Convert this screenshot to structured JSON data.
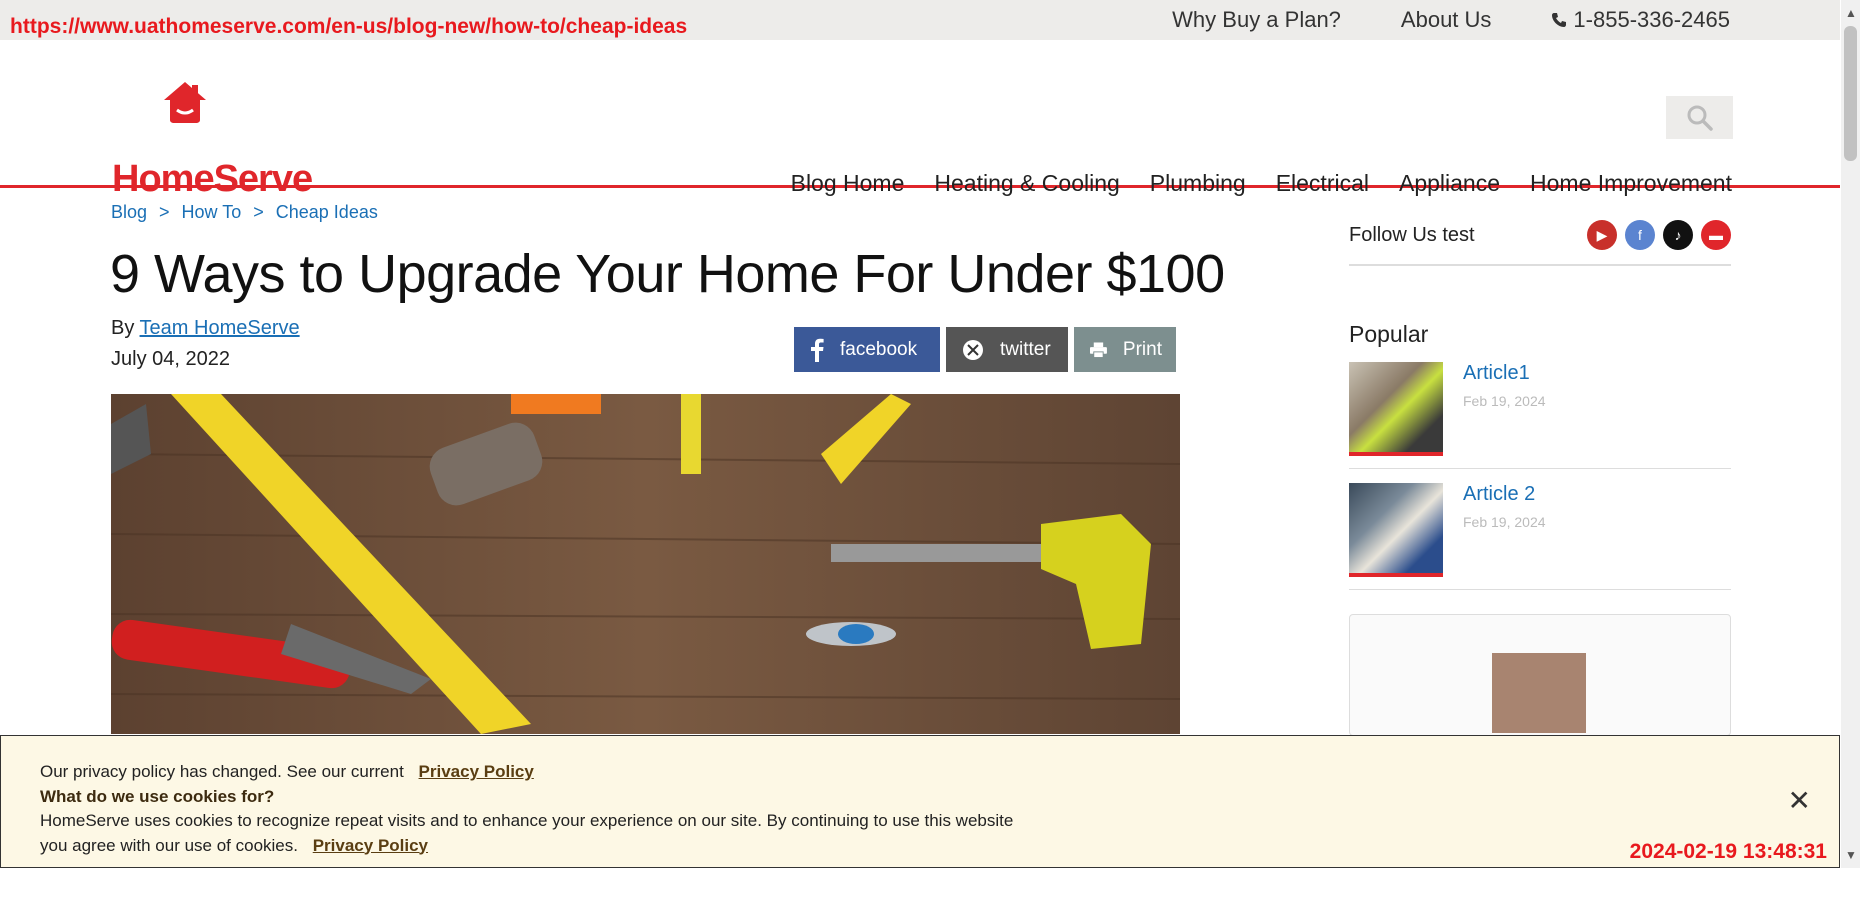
{
  "overlay": {
    "url": "https://www.uathomeserve.com/en-us/blog-new/how-to/cheap-ideas",
    "timestamp": "2024-02-19 13:48:31"
  },
  "topbar": {
    "why_buy": "Why Buy a Plan?",
    "about": "About Us",
    "phone": "1-855-336-2465"
  },
  "brand": {
    "name": "HomeServe",
    "color": "#e0262b"
  },
  "nav": [
    "Blog Home",
    "Heating & Cooling",
    "Plumbing",
    "Electrical",
    "Appliance",
    "Home Improvement"
  ],
  "breadcrumb": [
    "Blog",
    "How To",
    "Cheap Ideas"
  ],
  "article": {
    "title": "9 Ways to Upgrade Your Home For Under $100",
    "by_prefix": "By",
    "author": "Team HomeServe",
    "date": "July 04, 2022"
  },
  "share": {
    "facebook": "facebook",
    "twitter": "twitter",
    "print": "Print"
  },
  "sidebar": {
    "follow_label": "Follow Us test",
    "social_icons": [
      "youtube-icon",
      "facebook-icon",
      "tiktok-icon",
      "truck-icon"
    ],
    "popular_heading": "Popular",
    "articles": [
      {
        "title": "Article1",
        "date": "Feb 19, 2024"
      },
      {
        "title": "Article 2",
        "date": "Feb 19, 2024"
      }
    ]
  },
  "cookie": {
    "line1": "Our privacy policy has changed. See our current",
    "link1": "Privacy Policy",
    "heading": "What do we use cookies for?",
    "body": "HomeServe uses cookies to recognize repeat visits and to enhance your experience on our site. By continuing to use this website you agree with our use of cookies.",
    "link2": "Privacy Policy",
    "close": "✕"
  }
}
